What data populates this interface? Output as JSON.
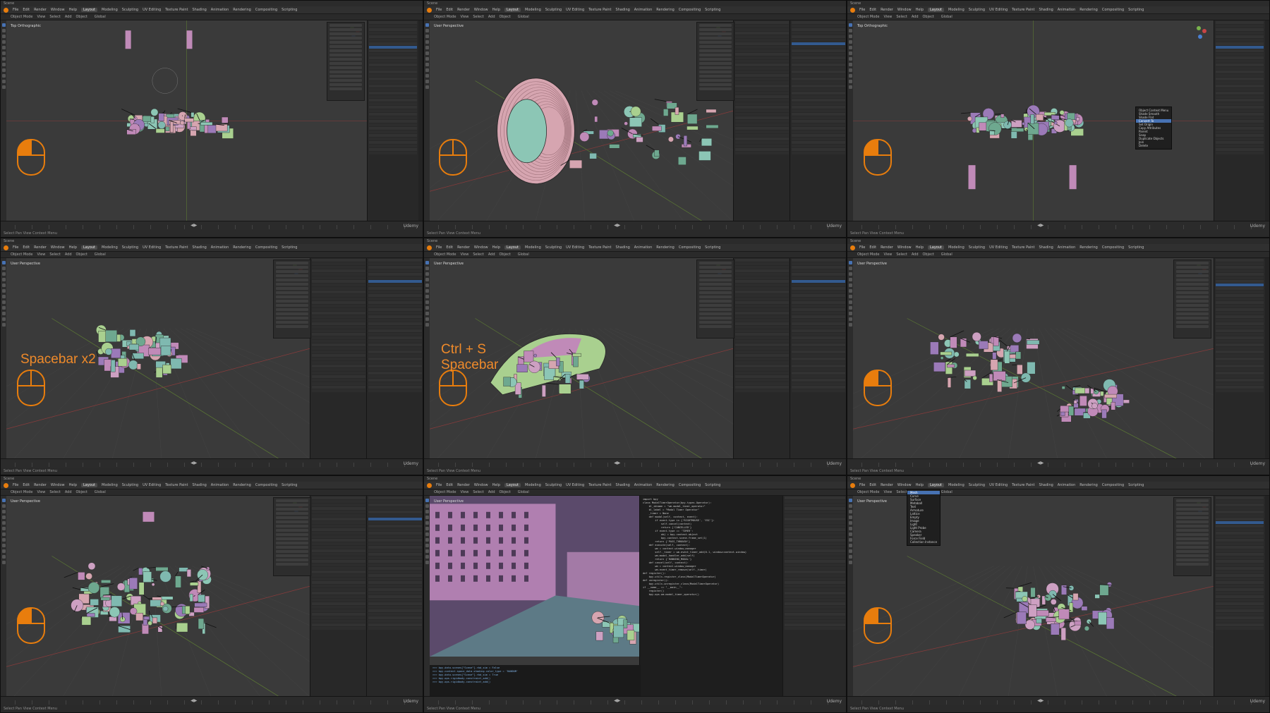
{
  "window": {
    "app_menu": [
      "File",
      "Edit",
      "Render",
      "Window",
      "Help"
    ],
    "workspaces": [
      "Layout",
      "Modeling",
      "Sculpting",
      "UV Editing",
      "Texture Paint",
      "Shading",
      "Animation",
      "Rendering",
      "Compositing",
      "Scripting"
    ],
    "active_workspace": "Layout",
    "scene_label": "Scene",
    "view_layer_label": "View Layer",
    "editor_menus": [
      "View",
      "Select",
      "Add",
      "Object"
    ],
    "mode": "Object Mode",
    "transform_orientation": "Global"
  },
  "tiles": [
    {
      "id": "tile-1",
      "view_label": "Top Orthographic",
      "accent": "#e87d0d",
      "status": "Select   Pan View   Context Menu",
      "watermark": "Udemy"
    },
    {
      "id": "tile-2",
      "view_label": "User Perspective",
      "accent": "#e87d0d",
      "status": "Select   Pan View   Context Menu",
      "watermark": "Udemy"
    },
    {
      "id": "tile-3",
      "view_label": "Top Orthographic",
      "accent": "#e87d0d",
      "status": "Select   Pan View   Context Menu",
      "watermark": "Udemy"
    },
    {
      "id": "tile-4",
      "view_label": "User Perspective",
      "hint": "Spacebar x2",
      "accent": "#e87d0d",
      "status": "Select   Pan View   Context Menu",
      "watermark": "Udemy"
    },
    {
      "id": "tile-5",
      "view_label": "User Perspective",
      "hint_line1": "Ctrl + S",
      "hint_line2": "Spacebar",
      "accent": "#e87d0d",
      "status": "Select   Pan View   Context Menu",
      "watermark": "Udemy"
    },
    {
      "id": "tile-6",
      "view_label": "User Perspective",
      "accent": "#e87d0d",
      "status": "Select   Pan View   Context Menu",
      "watermark": "Udemy"
    },
    {
      "id": "tile-7",
      "view_label": "User Perspective",
      "accent": "#e87d0d",
      "status": "Select   Pan View   Context Menu",
      "watermark": "Udemy"
    },
    {
      "id": "tile-8",
      "view_label": "User Perspective",
      "accent": "#e87d0d",
      "status": "Select   Pan View   Context Menu",
      "watermark": "Udemy"
    },
    {
      "id": "tile-9",
      "view_label": "User Perspective",
      "accent": "#e87d0d",
      "status": "Select   Pan View   Context Menu",
      "watermark": "Udemy"
    }
  ],
  "code": {
    "lines": [
      "import bpy",
      "",
      "class ModalTimerOperator(bpy.types.Operator):",
      "    bl_idname = \"wm.modal_timer_operator\"",
      "    bl_label = \"Modal Timer Operator\"",
      "",
      "    _timer = None",
      "",
      "    def modal(self, context, event):",
      "        if event.type in {'RIGHTMOUSE', 'ESC'}:",
      "            self.cancel(context)",
      "            return {'CANCELLED'}",
      "",
      "        if event.type == 'TIMER':",
      "            obj = bpy.context.object",
      "            bpy.context.scene.frame_set(1)",
      "",
      "        return {'PASS_THROUGH'}",
      "",
      "    def execute(self, context):",
      "        wm = context.window_manager",
      "        self._timer = wm.event_timer_add(0.1, window=context.window)",
      "        wm.modal_handler_add(self)",
      "        return {'RUNNING_MODAL'}",
      "",
      "    def cancel(self, context):",
      "        wm = context.window_manager",
      "        wm.event_timer_remove(self._timer)",
      "",
      "def register():",
      "    bpy.utils.register_class(ModalTimerOperator)",
      "",
      "def unregister():",
      "    bpy.utils.unregister_class(ModalTimerOperator)",
      "",
      "if __name__ == \"__main__\":",
      "    register()",
      "    bpy.ops.wm.modal_timer_operator()"
    ],
    "console": [
      ">>> bpy.data.scenes[\"Scene\"].rbd_sim = False",
      ">>> bpy.context.space_data.shading.color_type = 'RANDOM'",
      ">>> bpy.data.scenes[\"Scene\"].rbd_sim = True",
      ">>> bpy.ops.rigidbody.constraint_add()",
      ">>> bpy.ops.rigidbody.constraint_add()"
    ]
  },
  "context_menu": {
    "items": [
      "Object Context Menu",
      "Shade Smooth",
      "Shade Flat",
      "Convert To",
      "Set Origin",
      "Copy Attributes",
      "Parent",
      "Snap",
      "Duplicate Objects",
      "Join",
      "Delete"
    ],
    "highlight_index": 3
  },
  "add_menu": {
    "items": [
      "Mesh",
      "Curve",
      "Surface",
      "Metaball",
      "Text",
      "Armature",
      "Lattice",
      "Empty",
      "Image",
      "Light",
      "Light Probe",
      "Camera",
      "Speaker",
      "Force Field",
      "Collection Instance"
    ],
    "highlight_index": 0
  }
}
